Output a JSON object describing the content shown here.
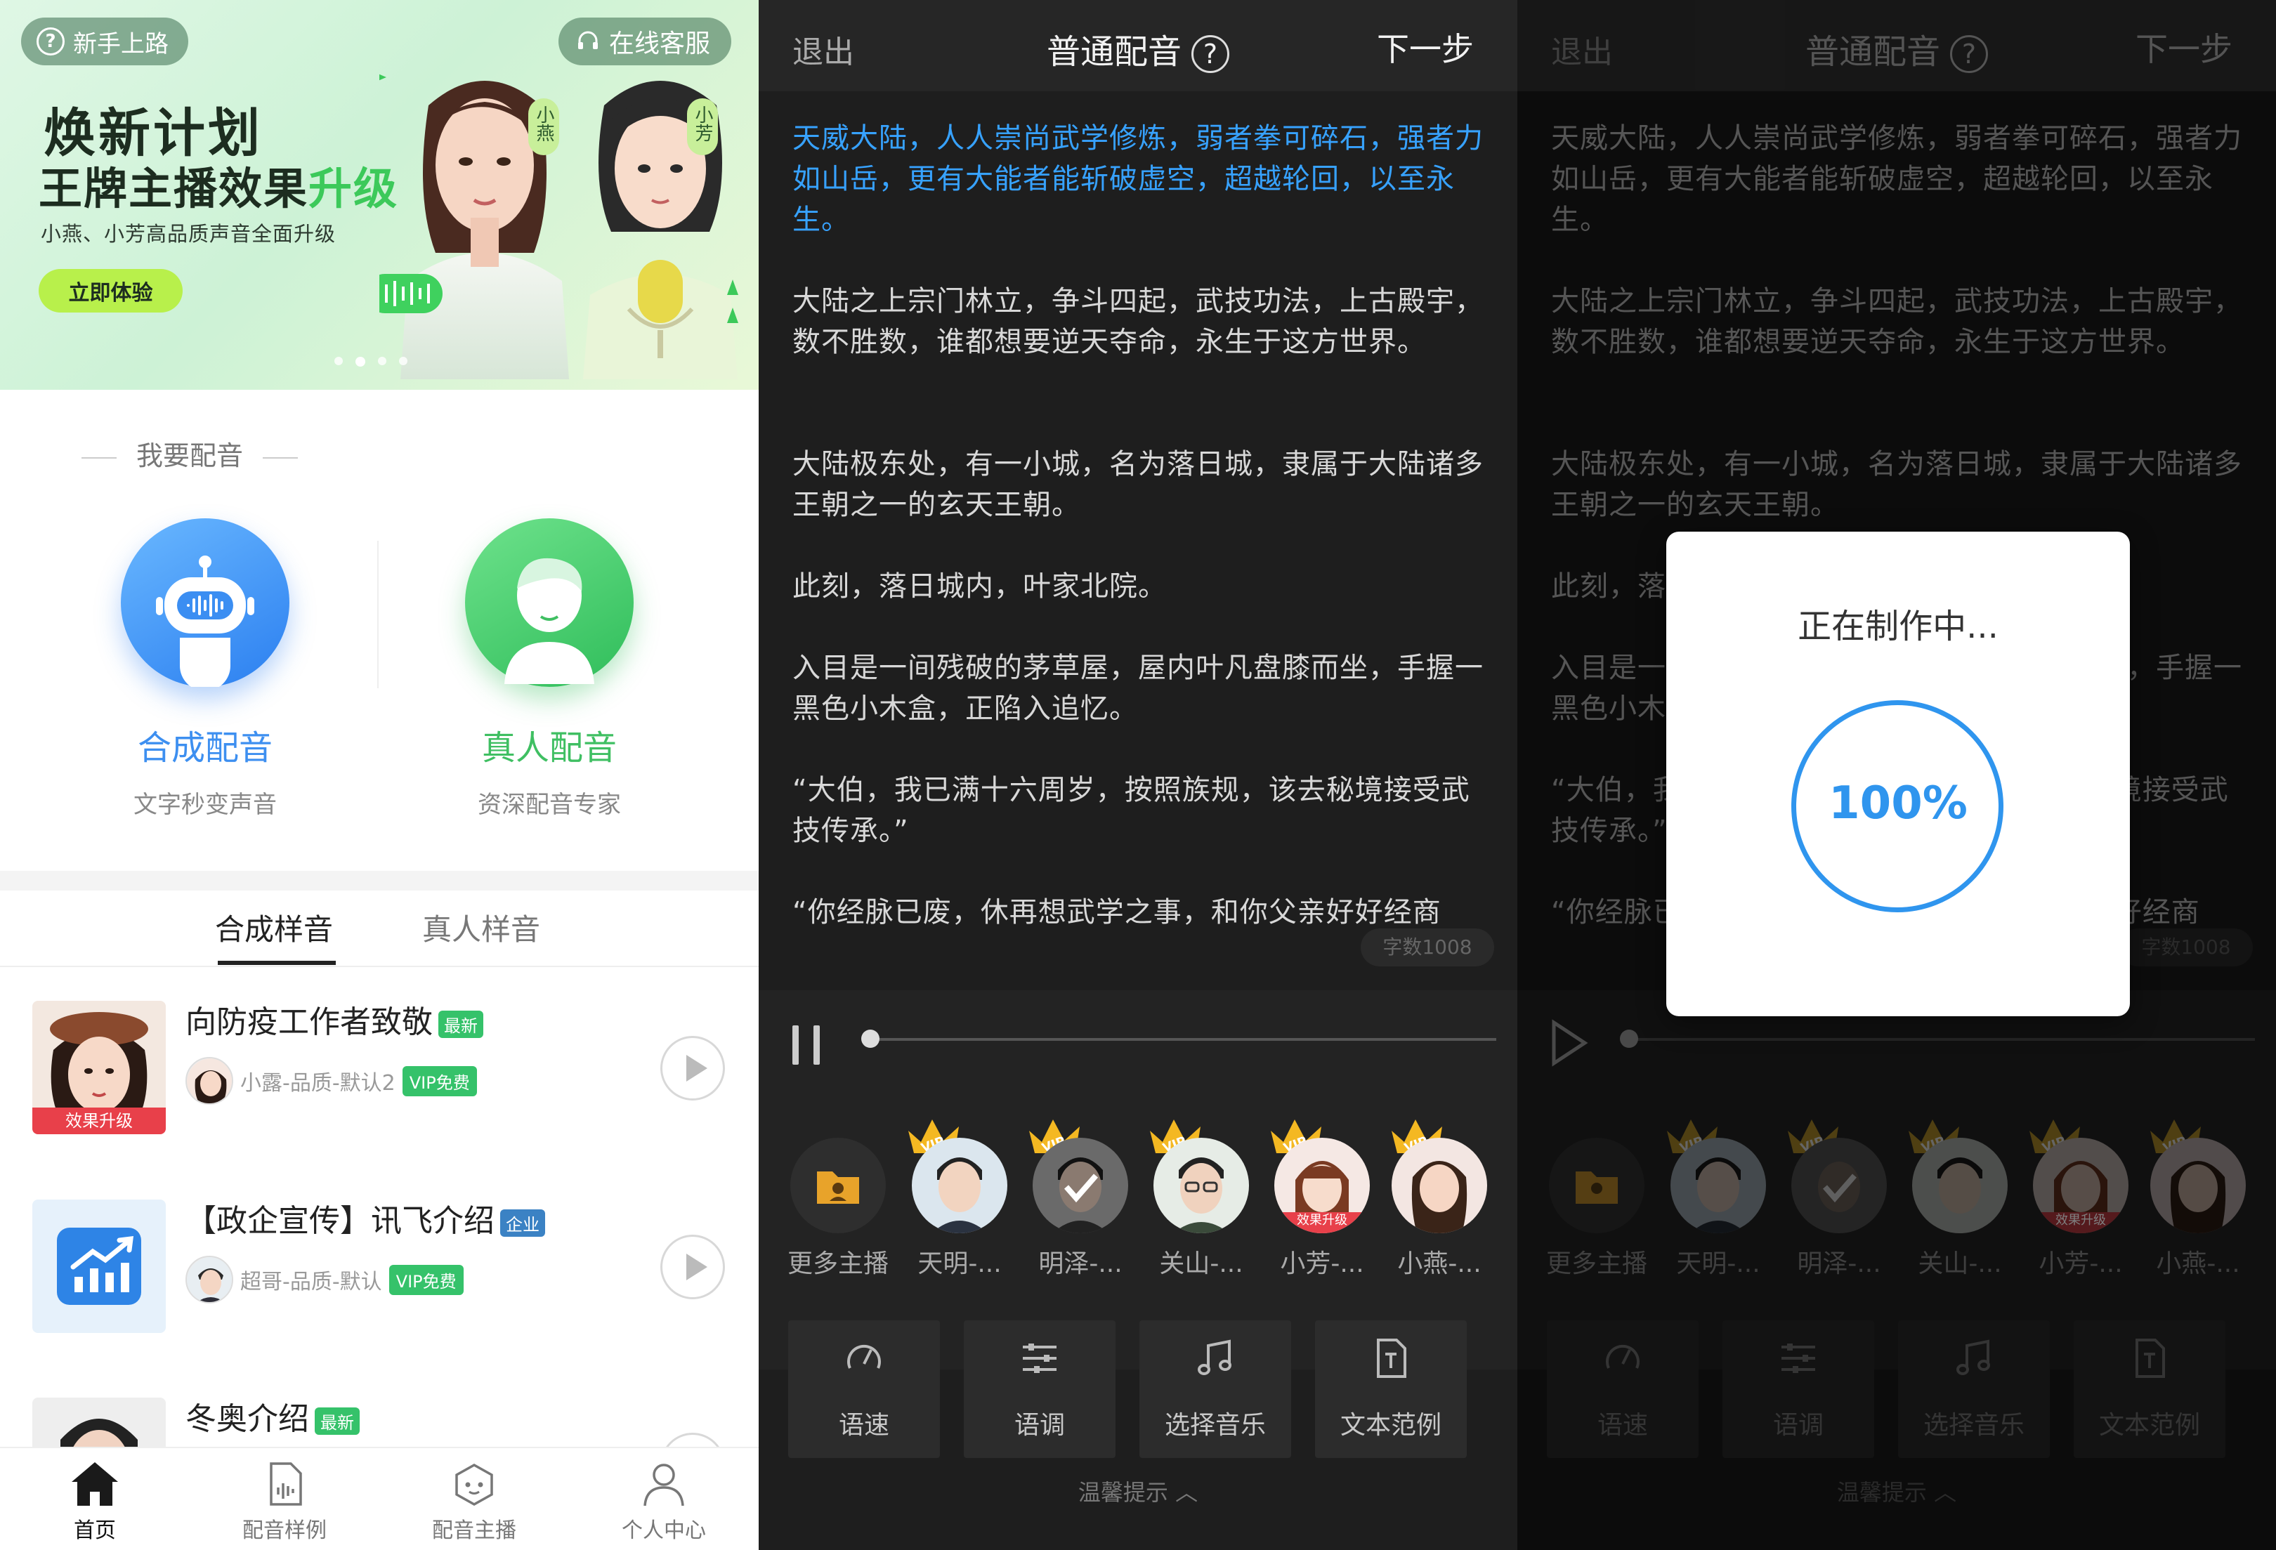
{
  "home": {
    "banner": {
      "help_label": "新手上路",
      "cs_label": "在线客服",
      "title_line1": "焕新计划",
      "title_line2a": "王牌主播效果",
      "title_line2b": "升级",
      "subtitle": "小燕、小芳高品质声音全面升级",
      "cta": "立即体验",
      "tag_left": "小燕",
      "tag_right": "小芳",
      "active_dot": 2
    },
    "section_title": "我要配音",
    "synth": {
      "label": "合成配音",
      "sub": "文字秒变声音"
    },
    "human": {
      "label": "真人配音",
      "sub": "资深配音专家"
    },
    "tabs": [
      "合成样音",
      "真人样音"
    ],
    "samples": [
      {
        "title": "向防疫工作者致敬",
        "badge": "最新",
        "badge_color": "#35c26a",
        "author": "小露-品质-默认2",
        "vip": "VIP免费",
        "thumb_tag": "效果升级"
      },
      {
        "title": "【政企宣传】讯飞介绍",
        "badge": "企业",
        "badge_color": "#3b82c4",
        "author": "超哥-品质-默认",
        "vip": "VIP免费"
      },
      {
        "title": "冬奥介绍",
        "badge": "最新",
        "badge_color": "#35c26a"
      }
    ],
    "nav": [
      "首页",
      "配音样例",
      "配音主播",
      "个人中心"
    ]
  },
  "editor": {
    "exit": "退出",
    "title": "普通配音",
    "help": "?",
    "next": "下一步",
    "paragraphs": [
      "天威大陆，人人崇尚武学修炼，弱者拳可碎石，强者力如山岳，更有大能者能斩破虚空，超越轮回，以至永生。",
      "大陆之上宗门林立，争斗四起，武技功法，上古殿宇，数不胜数，谁都想要逆天夺命，永生于这方世界。",
      "大陆极东处，有一小城，名为落日城，隶属于大陆诸多王朝之一的玄天王朝。",
      "此刻，落日城内，叶家北院。",
      "入目是一间残破的茅草屋，屋内叶凡盘膝而坐，手握一黑色小木盒，正陷入追忆。",
      "“大伯，我已满十六周岁，按照族规，该去秘境接受武技传承。”",
      "“你经脉已废，休再想武学之事，和你父亲好好经商"
    ],
    "word_count": "字数1008",
    "more_hosts": "更多主播",
    "hosts": [
      "天明-...",
      "明泽-...",
      "关山-...",
      "小芳-...",
      "小燕-..."
    ],
    "host_tag": "效果升级",
    "vip_badge": "VIP",
    "tools": [
      "语速",
      "语调",
      "选择音乐",
      "文本范例"
    ],
    "tip": "温馨提示"
  },
  "modal": {
    "title": "正在制作中...",
    "percent": "100%",
    "progress": 1.0
  }
}
